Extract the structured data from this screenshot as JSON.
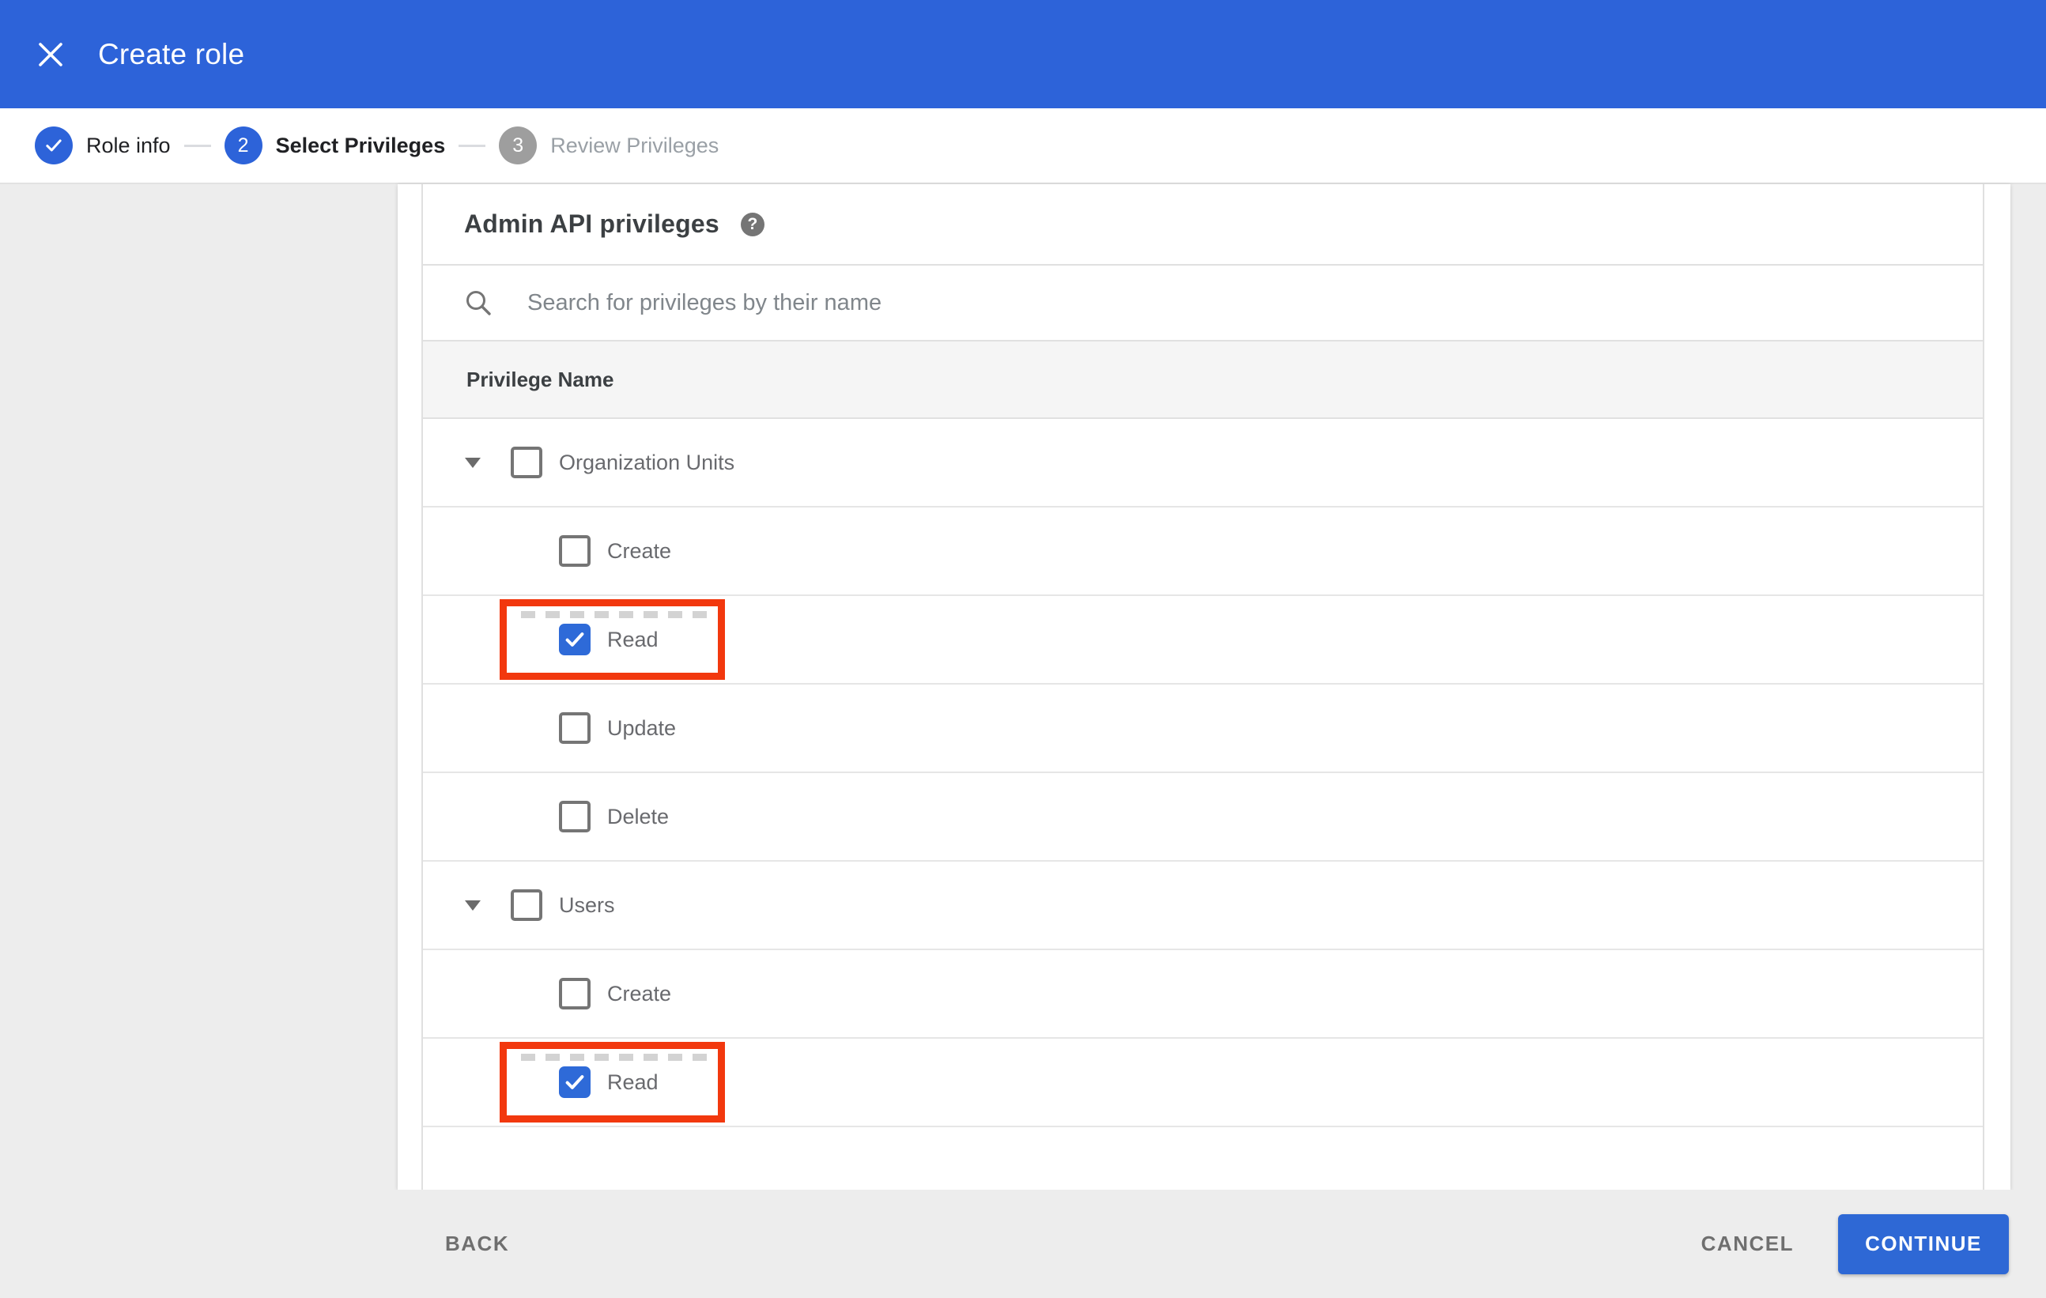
{
  "titlebar": {
    "title": "Create role"
  },
  "stepper": {
    "steps": [
      {
        "number": "1",
        "label": "Role info",
        "state": "complete"
      },
      {
        "number": "2",
        "label": "Select Privileges",
        "state": "active"
      },
      {
        "number": "3",
        "label": "Review Privileges",
        "state": "upcoming"
      }
    ]
  },
  "panel": {
    "title": "Admin API privileges",
    "help_glyph": "?"
  },
  "search": {
    "placeholder": "Search for privileges by their name",
    "value": ""
  },
  "table": {
    "header": "Privilege Name",
    "rows": [
      {
        "level": "parent",
        "label": "Organization Units",
        "checked": false,
        "expanded": true
      },
      {
        "level": "child",
        "label": "Create",
        "checked": false
      },
      {
        "level": "child",
        "label": "Read",
        "checked": true,
        "highlighted": true
      },
      {
        "level": "child",
        "label": "Update",
        "checked": false
      },
      {
        "level": "child",
        "label": "Delete",
        "checked": false
      },
      {
        "level": "parent",
        "label": "Users",
        "checked": false,
        "expanded": true
      },
      {
        "level": "child",
        "label": "Create",
        "checked": false
      },
      {
        "level": "child",
        "label": "Read",
        "checked": true,
        "highlighted": true
      }
    ]
  },
  "annotations": [
    {
      "shape": "red-box",
      "target": "Organization Units > Read"
    },
    {
      "shape": "red-box",
      "target": "Users > Read"
    }
  ],
  "footer": {
    "back": "BACK",
    "cancel": "CANCEL",
    "continue": "CONTINUE"
  },
  "colors": {
    "appbar_blue": "#2d63d9",
    "checkbox_blue": "#2e6ad8",
    "continue_blue": "#2e68d5",
    "highlight_red": "#f2380e",
    "inactive_gray": "#9e9e9e",
    "background_gray": "#ededed"
  }
}
